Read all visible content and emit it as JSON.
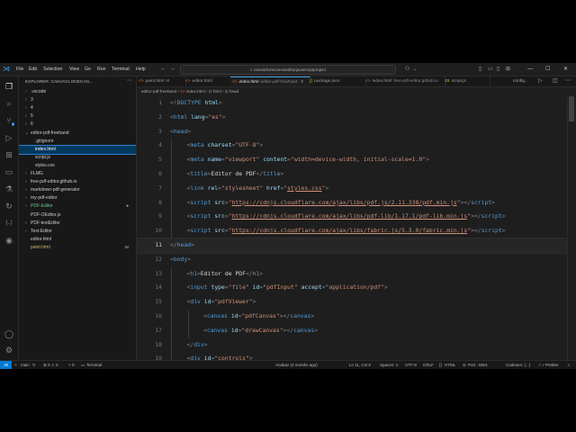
{
  "titlebar": {
    "menus": [
      "File",
      "Edit",
      "Selection",
      "View",
      "Go",
      "Run",
      "Terminal",
      "Help"
    ],
    "search": "canvaclonecanvaeditorjavascriptproject",
    "window_controls": [
      "—",
      "☐",
      "✕"
    ]
  },
  "sidebar": {
    "header": "EXPLORER: CANVACLONECAN...",
    "tree": [
      {
        "label": ".vscode",
        "kind": "folder",
        "depth": 1,
        "chev": "›"
      },
      {
        "label": "3",
        "kind": "folder",
        "depth": 1,
        "chev": "›"
      },
      {
        "label": "4",
        "kind": "folder",
        "depth": 1,
        "chev": "›"
      },
      {
        "label": "5",
        "kind": "folder",
        "depth": 1,
        "chev": "›"
      },
      {
        "label": "6",
        "kind": "folder",
        "depth": 1,
        "chev": "›"
      },
      {
        "label": "editor-pdf-freehand",
        "kind": "folder",
        "depth": 1,
        "chev": "⌄"
      },
      {
        "label": ".gitignore",
        "kind": "file",
        "depth": 2,
        "chev": ""
      },
      {
        "label": "index.html",
        "kind": "file",
        "depth": 2,
        "chev": "",
        "selected": true
      },
      {
        "label": "script.js",
        "kind": "file",
        "depth": 2,
        "chev": ""
      },
      {
        "label": "styles.css",
        "kind": "file",
        "depth": 2,
        "chev": ""
      },
      {
        "label": "FLMG",
        "kind": "folder",
        "depth": 1,
        "chev": "›"
      },
      {
        "label": "free-pdf-editor.github.io",
        "kind": "folder",
        "depth": 1,
        "chev": "›"
      },
      {
        "label": "markdown-pdf-generator",
        "kind": "folder",
        "depth": 1,
        "chev": "›"
      },
      {
        "label": "my-pdf-editor",
        "kind": "folder",
        "depth": 1,
        "chev": "›"
      },
      {
        "label": "PDF-Editor",
        "kind": "folder",
        "depth": 1,
        "chev": "›",
        "color": "#73c991",
        "dot": true
      },
      {
        "label": "PDF-OEditor.js",
        "kind": "file",
        "depth": 1,
        "chev": ""
      },
      {
        "label": "PDF-textEditor",
        "kind": "folder",
        "depth": 1,
        "chev": "›"
      },
      {
        "label": "Text-Editor",
        "kind": "folder",
        "depth": 1,
        "chev": "›"
      },
      {
        "label": "editor.html",
        "kind": "file",
        "depth": 1,
        "chev": ""
      },
      {
        "label": "paint.html",
        "kind": "file",
        "depth": 1,
        "chev": "",
        "badge": "M",
        "color": "#d3b76b"
      }
    ]
  },
  "tabs": [
    {
      "label": "paint.html",
      "desc": "M",
      "icon": "<>"
    },
    {
      "label": "editor.html",
      "desc": "",
      "icon": "<>"
    },
    {
      "label": "index.html",
      "desc": "editor-pdf-freehand",
      "icon": "<>",
      "active": true
    },
    {
      "label": "package.json",
      "desc": "",
      "icon": "{}"
    },
    {
      "label": "index.html",
      "desc": "free-pdf-editor.github.io",
      "icon": "<>"
    },
    {
      "label": "script.js",
      "desc": "",
      "icon": "JS"
    }
  ],
  "tab_actions": {
    "config": "config..."
  },
  "breadcrumb": [
    "editor-pdf-freehand",
    "index.html",
    "html",
    "head"
  ],
  "code": {
    "current_line": 11,
    "lines": [
      {
        "n": "1",
        "indent": 0,
        "tokens": [
          [
            "p",
            "<!"
          ],
          [
            "t",
            "DOCTYPE"
          ],
          [
            "x",
            " "
          ],
          [
            "a",
            "html"
          ],
          [
            "p",
            ">"
          ]
        ]
      },
      {
        "n": "2",
        "indent": 0,
        "tokens": [
          [
            "p",
            "<"
          ],
          [
            "t",
            "html"
          ],
          [
            "x",
            " "
          ],
          [
            "a",
            "lang"
          ],
          [
            "p",
            "="
          ],
          [
            "s",
            "\"es\""
          ],
          [
            "p",
            ">"
          ]
        ]
      },
      {
        "n": "3",
        "indent": 0,
        "tokens": [
          [
            "p",
            "<"
          ],
          [
            "t",
            "head"
          ],
          [
            "p",
            ">"
          ]
        ]
      },
      {
        "n": "4",
        "indent": 1,
        "tokens": [
          [
            "p",
            "<"
          ],
          [
            "t",
            "meta"
          ],
          [
            "x",
            " "
          ],
          [
            "a",
            "charset"
          ],
          [
            "p",
            "="
          ],
          [
            "s",
            "\"UTF-8\""
          ],
          [
            "p",
            ">"
          ]
        ]
      },
      {
        "n": "5",
        "indent": 1,
        "tokens": [
          [
            "p",
            "<"
          ],
          [
            "t",
            "meta"
          ],
          [
            "x",
            " "
          ],
          [
            "a",
            "name"
          ],
          [
            "p",
            "="
          ],
          [
            "s",
            "\"viewport\""
          ],
          [
            "x",
            " "
          ],
          [
            "a",
            "content"
          ],
          [
            "p",
            "="
          ],
          [
            "s",
            "\"width=device-width, initial-scale=1.0\""
          ],
          [
            "p",
            ">"
          ]
        ]
      },
      {
        "n": "6",
        "indent": 1,
        "tokens": [
          [
            "p",
            "<"
          ],
          [
            "t",
            "title"
          ],
          [
            "p",
            ">"
          ],
          [
            "x",
            "Editor de PDF"
          ],
          [
            "p",
            "</"
          ],
          [
            "t",
            "title"
          ],
          [
            "p",
            ">"
          ]
        ]
      },
      {
        "n": "7",
        "indent": 1,
        "tokens": [
          [
            "p",
            "<"
          ],
          [
            "t",
            "link"
          ],
          [
            "x",
            " "
          ],
          [
            "a",
            "rel"
          ],
          [
            "p",
            "="
          ],
          [
            "s",
            "\"stylesheet\""
          ],
          [
            "x",
            " "
          ],
          [
            "a",
            "href"
          ],
          [
            "p",
            "="
          ],
          [
            "s",
            "\""
          ],
          [
            "l",
            "styles.css"
          ],
          [
            "s",
            "\""
          ],
          [
            "p",
            ">"
          ]
        ]
      },
      {
        "n": "8",
        "indent": 1,
        "tokens": [
          [
            "p",
            "<"
          ],
          [
            "t",
            "script"
          ],
          [
            "x",
            " "
          ],
          [
            "a",
            "src"
          ],
          [
            "p",
            "="
          ],
          [
            "s",
            "\""
          ],
          [
            "l",
            "https://cdnjs.cloudflare.com/ajax/libs/pdf.js/2.11.338/pdf.min.js"
          ],
          [
            "s",
            "\""
          ],
          [
            "p",
            "></"
          ],
          [
            "t",
            "script"
          ],
          [
            "p",
            ">"
          ]
        ]
      },
      {
        "n": "9",
        "indent": 1,
        "tokens": [
          [
            "p",
            "<"
          ],
          [
            "t",
            "script"
          ],
          [
            "x",
            " "
          ],
          [
            "a",
            "src"
          ],
          [
            "p",
            "="
          ],
          [
            "s",
            "\""
          ],
          [
            "l",
            "https://cdnjs.cloudflare.com/ajax/libs/pdf-lib/1.17.1/pdf-lib.min.js"
          ],
          [
            "s",
            "\""
          ],
          [
            "p",
            "></"
          ],
          [
            "t",
            "script"
          ],
          [
            "p",
            ">"
          ]
        ]
      },
      {
        "n": "10",
        "indent": 1,
        "tokens": [
          [
            "p",
            "<"
          ],
          [
            "t",
            "script"
          ],
          [
            "x",
            " "
          ],
          [
            "a",
            "src"
          ],
          [
            "p",
            "="
          ],
          [
            "s",
            "\""
          ],
          [
            "l",
            "https://cdnjs.cloudflare.com/ajax/libs/fabric.js/5.3.0/fabric.min.js"
          ],
          [
            "s",
            "\""
          ],
          [
            "p",
            "></"
          ],
          [
            "t",
            "script"
          ],
          [
            "p",
            ">"
          ]
        ]
      },
      {
        "n": "11",
        "indent": 0,
        "tokens": [
          [
            "p",
            "</"
          ],
          [
            "t",
            "head"
          ],
          [
            "p",
            ">"
          ]
        ]
      },
      {
        "n": "12",
        "indent": 0,
        "tokens": [
          [
            "p",
            "<"
          ],
          [
            "t",
            "body"
          ],
          [
            "p",
            ">"
          ]
        ]
      },
      {
        "n": "13",
        "indent": 1,
        "tokens": [
          [
            "p",
            "<"
          ],
          [
            "t",
            "h1"
          ],
          [
            "p",
            ">"
          ],
          [
            "x",
            "Editor de PDF"
          ],
          [
            "p",
            "</"
          ],
          [
            "t",
            "h1"
          ],
          [
            "p",
            ">"
          ]
        ]
      },
      {
        "n": "14",
        "indent": 1,
        "tokens": [
          [
            "p",
            "<"
          ],
          [
            "t",
            "input"
          ],
          [
            "x",
            " "
          ],
          [
            "a",
            "type"
          ],
          [
            "p",
            "="
          ],
          [
            "s",
            "\"file\""
          ],
          [
            "x",
            " "
          ],
          [
            "a",
            "id"
          ],
          [
            "p",
            "="
          ],
          [
            "s",
            "\"pdfInput\""
          ],
          [
            "x",
            " "
          ],
          [
            "a",
            "accept"
          ],
          [
            "p",
            "="
          ],
          [
            "s",
            "\"application/pdf\""
          ],
          [
            "p",
            ">"
          ]
        ]
      },
      {
        "n": "15",
        "indent": 1,
        "tokens": [
          [
            "p",
            "<"
          ],
          [
            "t",
            "div"
          ],
          [
            "x",
            " "
          ],
          [
            "a",
            "id"
          ],
          [
            "p",
            "="
          ],
          [
            "s",
            "\"pdfViewer\""
          ],
          [
            "p",
            ">"
          ]
        ]
      },
      {
        "n": "16",
        "indent": 2,
        "tokens": [
          [
            "p",
            "<"
          ],
          [
            "t",
            "canvas"
          ],
          [
            "x",
            " "
          ],
          [
            "a",
            "id"
          ],
          [
            "p",
            "="
          ],
          [
            "s",
            "\"pdfCanvas\""
          ],
          [
            "p",
            "></"
          ],
          [
            "t",
            "canvas"
          ],
          [
            "p",
            ">"
          ]
        ]
      },
      {
        "n": "17",
        "indent": 2,
        "tokens": [
          [
            "p",
            "<"
          ],
          [
            "t",
            "canvas"
          ],
          [
            "x",
            " "
          ],
          [
            "a",
            "id"
          ],
          [
            "p",
            "="
          ],
          [
            "s",
            "\"drawCanvas\""
          ],
          [
            "p",
            "></"
          ],
          [
            "t",
            "canvas"
          ],
          [
            "p",
            ">"
          ]
        ]
      },
      {
        "n": "18",
        "indent": 1,
        "tokens": [
          [
            "p",
            "</"
          ],
          [
            "t",
            "div"
          ],
          [
            "p",
            ">"
          ]
        ]
      },
      {
        "n": "19",
        "indent": 1,
        "tokens": [
          [
            "p",
            "<"
          ],
          [
            "t",
            "div"
          ],
          [
            "x",
            " "
          ],
          [
            "a",
            "id"
          ],
          [
            "p",
            "="
          ],
          [
            "s",
            "\"controls\""
          ],
          [
            "p",
            ">"
          ]
        ]
      }
    ]
  },
  "statusbar": {
    "branch": "main",
    "problems": "⊗ 0 ⚠ 0",
    "ports": "⑂ 0",
    "terminal": "Terminal",
    "blame": "Anabaz (2 months ago)",
    "cursor": "Ln 11, Col 8",
    "spaces": "Spaces: 4",
    "encoding": "UTF-8",
    "eol": "CRLF",
    "language": "HTML",
    "port": "Port : 5501",
    "codeium": "Codeium: {...}",
    "prettier": "Prettier"
  },
  "colors": {
    "accent": "#3c9ee8",
    "selection": "#04395e",
    "statusbar_remote": "#0078d4"
  }
}
